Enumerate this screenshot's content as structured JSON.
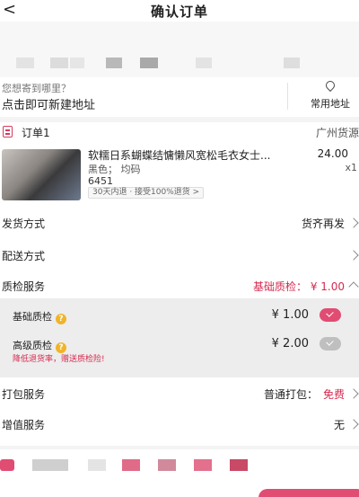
{
  "header": {
    "title": "确认订单",
    "back_icon": "back-arrow-icon"
  },
  "address": {
    "hint": "您想寄到哪里？",
    "main": "点击即可新建地址",
    "common_label": "常用地址"
  },
  "order": {
    "label": "订单1",
    "warehouse": "广州货源",
    "product": {
      "name": "软糯日系蝴蝶结慵懒风宽松毛衣女士...",
      "spec": "黑色； 均码",
      "code": "6451",
      "price": "24.00",
      "qty": "x1",
      "return_policy": "30天内退 · 接受100%退货 >"
    }
  },
  "rows": {
    "shipping": {
      "label": "发货方式",
      "value": "货齐再发"
    },
    "delivery": {
      "label": "配送方式",
      "value": ""
    },
    "qc": {
      "label": "质检服务",
      "value": "基础质检： ¥ 1.00"
    },
    "packing": {
      "label": "打包服务",
      "value_prefix": "普通打包：",
      "value_highlight": "免费"
    },
    "value_added": {
      "label": "增值服务",
      "value": "无"
    }
  },
  "qc_options": [
    {
      "label": "基础质检",
      "price": "¥ 1.00",
      "selected": true
    },
    {
      "label": "高级质检",
      "price": "¥ 2.00",
      "selected": false,
      "note": "降低退货率，赠送质检险!"
    }
  ],
  "colors": {
    "accent": "#e14c73",
    "warning": "#f0b429"
  }
}
